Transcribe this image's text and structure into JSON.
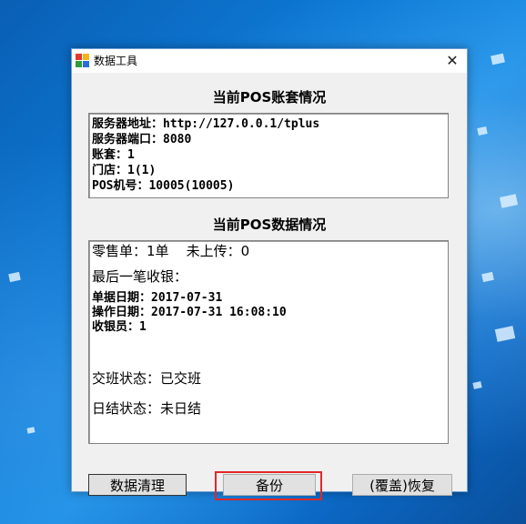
{
  "window": {
    "title": "数据工具",
    "close_glyph": "✕"
  },
  "account_section": {
    "heading": "当前POS账套情况",
    "lines": [
      "服务器地址：http://127.0.0.1/tplus",
      "服务器端口：8080",
      "账套：1",
      "门店：1(1)",
      "POS机号：10005(10005)"
    ]
  },
  "data_section": {
    "heading": "当前POS数据情况",
    "retail_line": "零售单：1单    未上传：0",
    "last_receipt_label": "最后一笔收银：",
    "doc_date": "单据日期：2017-07-31",
    "op_date": "操作日期：2017-07-31 16:08:10",
    "cashier": "收银员：1",
    "shift_status": "交班状态：已交班",
    "daily_status": "日结状态：未日结"
  },
  "buttons": {
    "clear": "数据清理",
    "backup": "备份",
    "restore": "(覆盖)恢复"
  },
  "colors": {
    "highlight": "#e0282a",
    "desktop": "#0d7ad6"
  }
}
